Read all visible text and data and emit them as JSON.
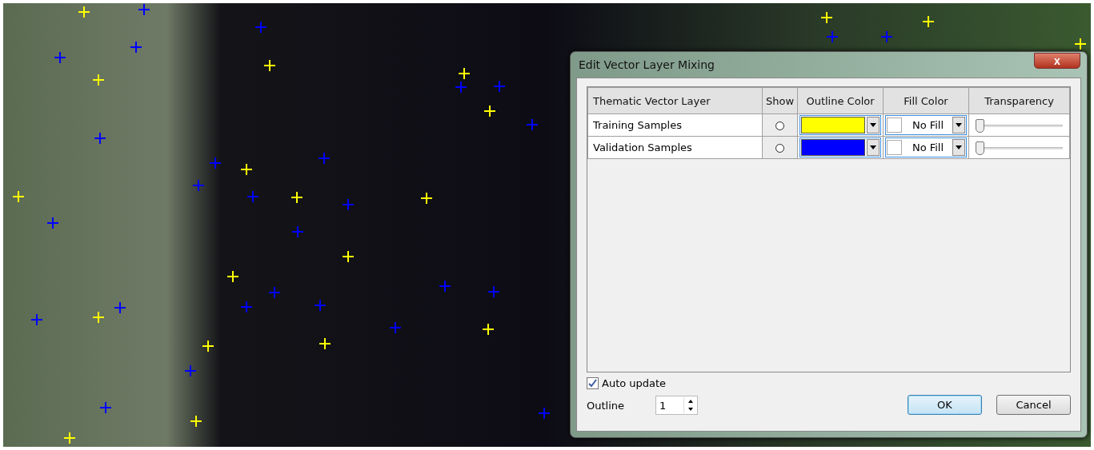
{
  "dialog": {
    "title": "Edit Vector Layer Mixing",
    "close": "x",
    "table": {
      "columns": [
        "Thematic Vector Layer",
        "Show",
        "Outline Color",
        "Fill Color",
        "Transparency"
      ],
      "rows": [
        {
          "name": "Training Samples",
          "show": false,
          "color": "#ffff00",
          "fill": "No Fill",
          "level": 0
        },
        {
          "name": "Validation Samples",
          "show": false,
          "color": "#0000ff",
          "fill": "No Fill",
          "level": 0
        }
      ]
    },
    "auto_update": {
      "label": "Auto update",
      "checked": true
    },
    "outline": {
      "label": "Outline",
      "value": "1"
    },
    "buttons": [
      "OK",
      "Cancel"
    ]
  }
}
